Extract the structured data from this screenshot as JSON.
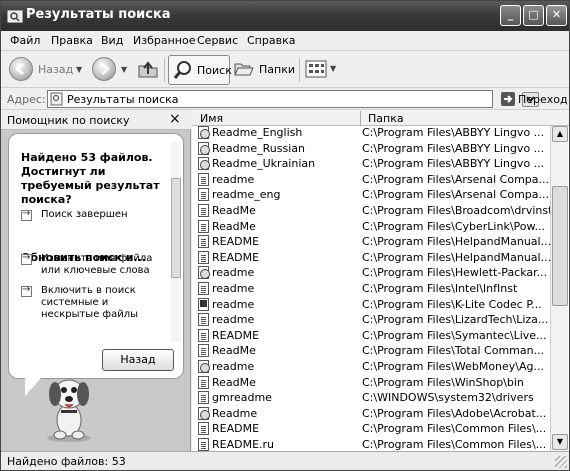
{
  "window": {
    "title": "Результаты поиска"
  },
  "menu": [
    "Файл",
    "Правка",
    "Вид",
    "Избранное",
    "Сервис",
    "Справка"
  ],
  "toolbar": {
    "back": "Назад",
    "search": "Поиск",
    "folders": "Папки"
  },
  "address": {
    "label": "Адрес:",
    "value": "Результаты поиска",
    "go": "Переход"
  },
  "assistant": {
    "title": "Помощник по поиску",
    "heading": "Найдено 53 файлов. Достигнут ли требуемый результат поиска?",
    "done": "Поиск завершен",
    "refine_heading": "Обновить поиск и...",
    "refine_name": "Изменить имя файла или ключевые слова",
    "include_hidden": "Включить в поиск системные и нескрытые файлы",
    "back_button": "Назад"
  },
  "columns": {
    "name": "Имя",
    "folder": "Папка"
  },
  "files": [
    {
      "icon": "globe-doc-icon",
      "name": "Readme_English",
      "folder": "C:\\Program Files\\ABBYY Lingvo ..."
    },
    {
      "icon": "globe-doc-icon",
      "name": "Readme_Russian",
      "folder": "C:\\Program Files\\ABBYY Lingvo ..."
    },
    {
      "icon": "globe-doc-icon",
      "name": "Readme_Ukrainian",
      "folder": "C:\\Program Files\\ABBYY Lingvo ..."
    },
    {
      "icon": "text-doc-icon",
      "name": "readme",
      "folder": "C:\\Program Files\\Arsenal Compa..."
    },
    {
      "icon": "text-doc-icon",
      "name": "readme_eng",
      "folder": "C:\\Program Files\\Arsenal Compa..."
    },
    {
      "icon": "text-doc-icon",
      "name": "ReadMe",
      "folder": "C:\\Program Files\\Broadcom\\drvinst"
    },
    {
      "icon": "text-doc-icon",
      "name": "ReadMe",
      "folder": "C:\\Program Files\\CyberLink\\Pow..."
    },
    {
      "icon": "text-doc-icon",
      "name": "README",
      "folder": "C:\\Program Files\\HelpandManual..."
    },
    {
      "icon": "text-doc-icon",
      "name": "README",
      "folder": "C:\\Program Files\\HelpandManual..."
    },
    {
      "icon": "globe-doc-icon",
      "name": "readme",
      "folder": "C:\\Program Files\\Hewlett-Packar..."
    },
    {
      "icon": "text-doc-icon",
      "name": "readme",
      "folder": "C:\\Program Files\\Intel\\InfInst"
    },
    {
      "icon": "ki-doc-icon",
      "name": "readme",
      "folder": "C:\\Program Files\\K-Lite Codec P..."
    },
    {
      "icon": "text-doc-icon",
      "name": "readme",
      "folder": "C:\\Program Files\\LizardTech\\Liza..."
    },
    {
      "icon": "text-doc-icon",
      "name": "README",
      "folder": "C:\\Program Files\\Symantec\\Live..."
    },
    {
      "icon": "text-doc-icon",
      "name": "ReadMe",
      "folder": "C:\\Program Files\\Total Comman..."
    },
    {
      "icon": "globe-doc-icon",
      "name": "readme",
      "folder": "C:\\Program Files\\WebMoney\\Ag..."
    },
    {
      "icon": "text-doc-icon",
      "name": "ReadMe",
      "folder": "C:\\Program Files\\WinShop\\bin"
    },
    {
      "icon": "text-doc-icon",
      "name": "gmreadme",
      "folder": "C:\\WINDOWS\\system32\\drivers"
    },
    {
      "icon": "globe-doc-icon",
      "name": "Readme",
      "folder": "C:\\Program Files\\Adobe\\Acrobat..."
    },
    {
      "icon": "text-doc-icon",
      "name": "README",
      "folder": "C:\\Program Files\\Common Files\\..."
    },
    {
      "icon": "text-doc-icon",
      "name": "README.ru",
      "folder": "C:\\Program Files\\Common Files\\..."
    }
  ],
  "status": {
    "text": "Найдено файлов: 53"
  }
}
